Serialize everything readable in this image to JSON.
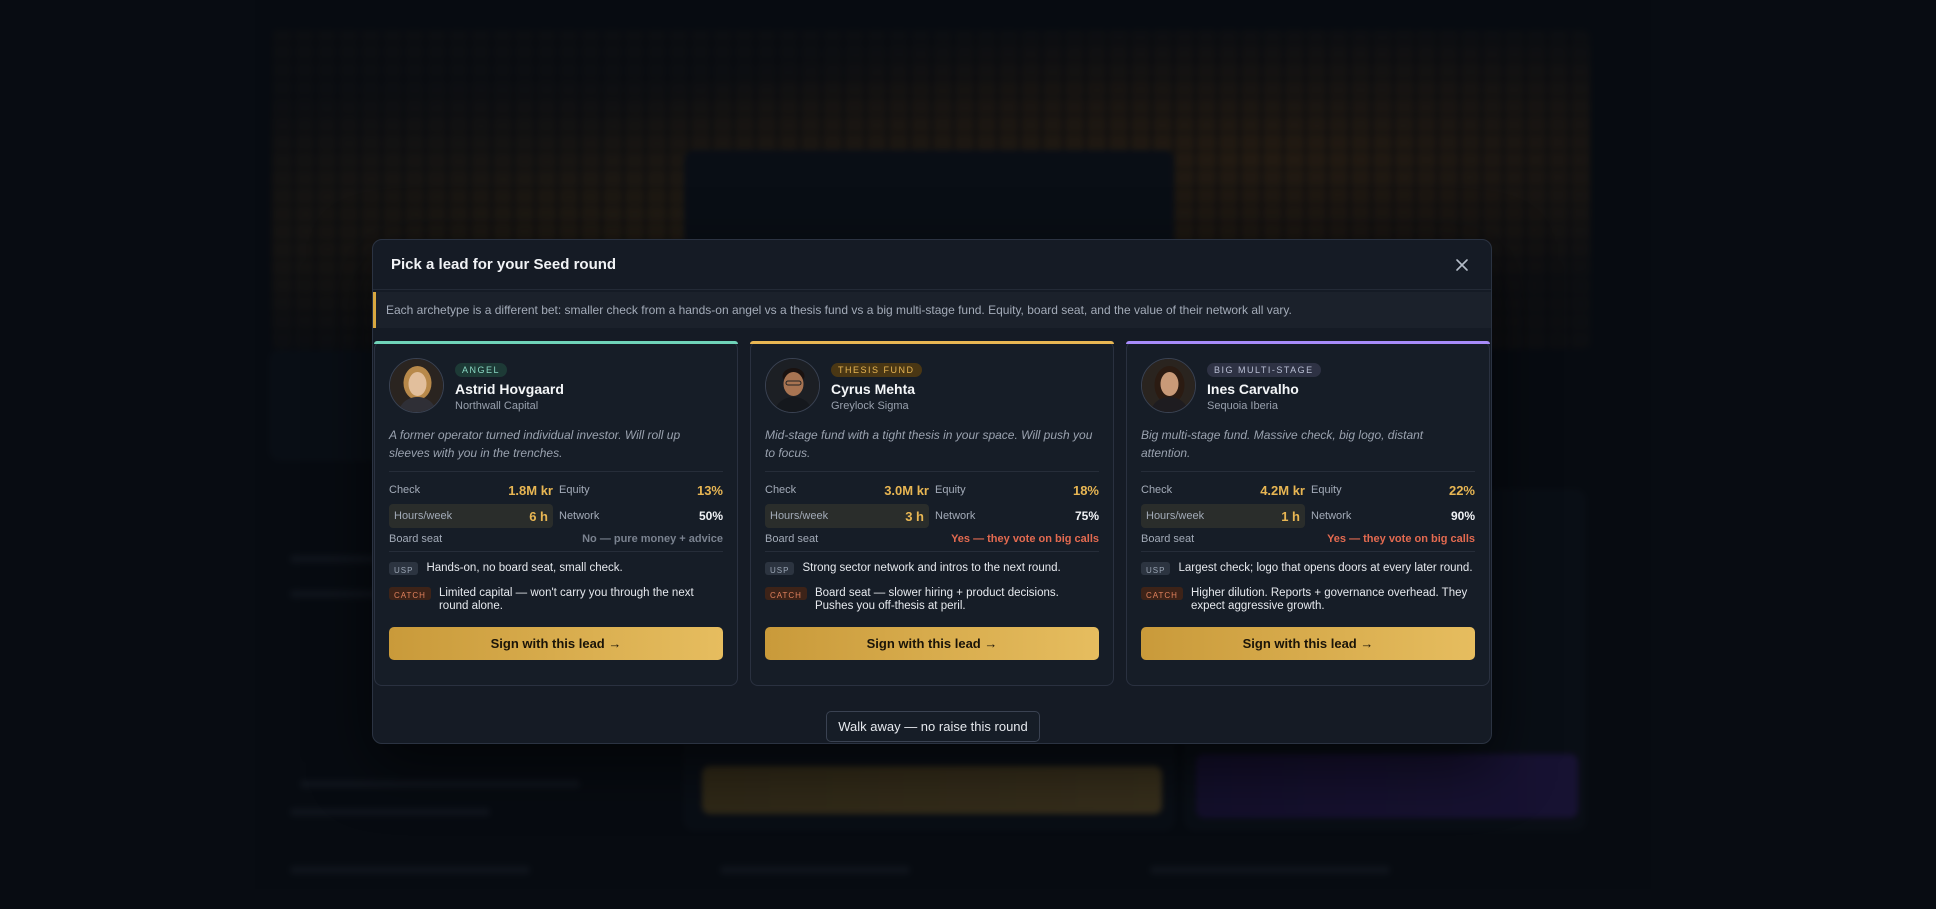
{
  "modal": {
    "title": "Pick a lead for your Seed round",
    "notice": "Each archetype is a different bet: smaller check from a hands-on angel vs a thesis fund vs a big multi-stage fund. Equity, board seat, and the value of their network all vary.",
    "walk_away_label": "Walk away — no raise this round"
  },
  "labels": {
    "check": "Check",
    "equity": "Equity",
    "hours_week": "Hours/week",
    "network": "Network",
    "board_seat": "Board seat",
    "usp": "USP",
    "catch": "CATCH",
    "sign_button": "Sign with this lead →"
  },
  "leads": [
    {
      "archetype": "ANGEL",
      "name": "Astrid Hovgaard",
      "firm": "Northwall Capital",
      "blurb": "A former operator turned individual investor. Will roll up sleeves with you in the trenches.",
      "check": "1.8M kr",
      "equity": "13%",
      "hours": "6 h",
      "network": "50%",
      "board_seat": "No — pure money + advice",
      "usp": "Hands-on, no board seat, small check.",
      "catch": "Limited capital — won't carry you through the next round alone."
    },
    {
      "archetype": "THESIS FUND",
      "name": "Cyrus Mehta",
      "firm": "Greylock Sigma",
      "blurb": "Mid-stage fund with a tight thesis in your space. Will push you to focus.",
      "check": "3.0M kr",
      "equity": "18%",
      "hours": "3 h",
      "network": "75%",
      "board_seat": "Yes — they vote on big calls",
      "usp": "Strong sector network and intros to the next round.",
      "catch": "Board seat — slower hiring + product decisions. Pushes you off-thesis at peril."
    },
    {
      "archetype": "BIG MULTI-STAGE",
      "name": "Ines Carvalho",
      "firm": "Sequoia Iberia",
      "blurb": "Big multi-stage fund. Massive check, big logo, distant attention.",
      "check": "4.2M kr",
      "equity": "22%",
      "hours": "1 h",
      "network": "90%",
      "board_seat": "Yes — they vote on big calls",
      "usp": "Largest check; logo that opens doors at every later round.",
      "catch": "Higher dilution. Reports + governance overhead. They expect aggressive growth."
    }
  ],
  "colors": {
    "angel_accent": "#6fd3b8",
    "thesis_accent": "#e8b653",
    "big_accent": "#a78bfa",
    "gold_value": "#e8b653",
    "board_yes": "#e36a50"
  }
}
